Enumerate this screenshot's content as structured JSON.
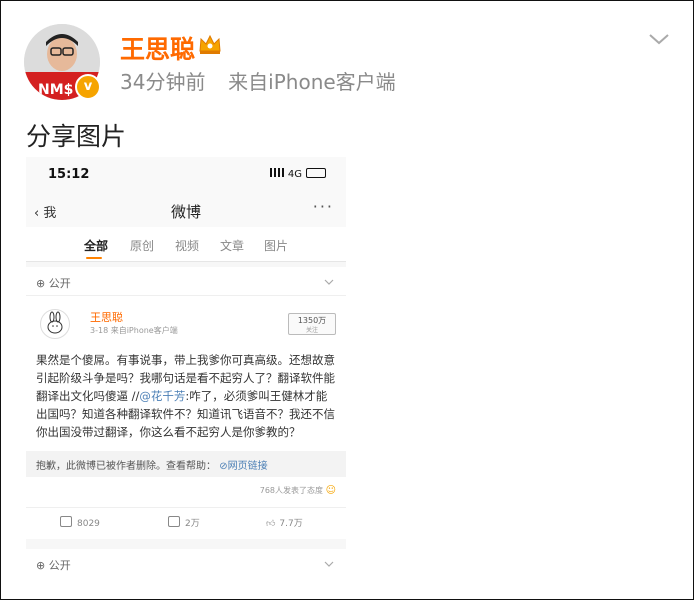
{
  "post": {
    "author": "王思聪",
    "timestamp": "34分钟前",
    "source": "来自iPhone客户端",
    "avatar_badge": "v",
    "text": "分享图片"
  },
  "screenshot": {
    "status_bar": {
      "time": "15:12",
      "network": "4G"
    },
    "nav": {
      "back_label": "我",
      "title": "微博",
      "more": "···"
    },
    "tabs": [
      "全部",
      "原创",
      "视频",
      "文章",
      "图片"
    ],
    "active_tab": "全部",
    "visibility": "公开",
    "weibo": {
      "author": "王思聪",
      "date": "3-18",
      "source": "来自iPhone客户端",
      "follower_count": "1350万",
      "follower_label": "关注",
      "text_part1": "果然是个傻屌。有事说事，带上我爹你可真高级。还想故意引起阶级斗争是吗？我哪句话是看不起穷人了？翻译软件能翻译出文化吗傻逼 //",
      "mention": "@花千芳",
      "text_part2": ":咋了，必须爹叫王健林才能出国吗？知道各种翻译软件不？知道讯飞语音不？我还不信你出国没带过翻译，你这么看不起穷人是你爹教的？",
      "deleted_notice": "抱歉，此微博已被作者删除。查看帮助：",
      "deleted_link": "网页链接",
      "reactions": "768人发表了态度",
      "actions": {
        "repost": "8029",
        "comment": "2万",
        "like": "7.7万"
      }
    },
    "visibility_2": "公开"
  },
  "colors": {
    "accent": "#ff6a00",
    "link": "#4b7fb5",
    "tab_underline": "#ff8200"
  }
}
